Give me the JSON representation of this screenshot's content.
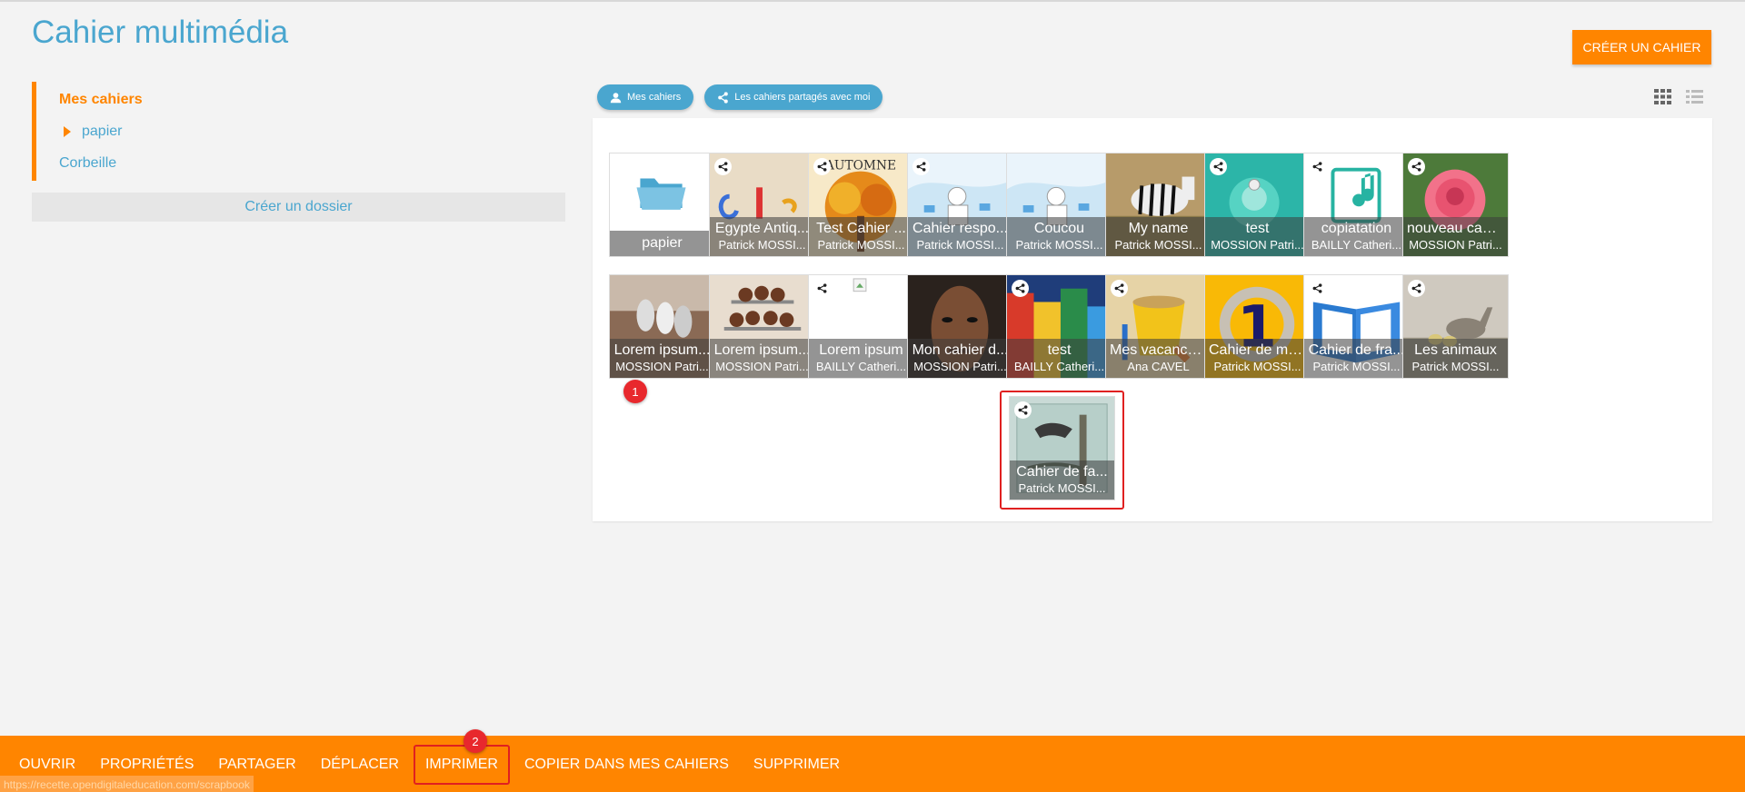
{
  "header": {
    "title": "Cahier multimédia",
    "create_label": "CRÉER UN CAHIER"
  },
  "sidebar": {
    "items": [
      {
        "label": "Mes cahiers"
      },
      {
        "label": "papier"
      },
      {
        "label": "Corbeille"
      }
    ],
    "create_folder_label": "Créer un dossier"
  },
  "filters": {
    "mine_label": "Mes cahiers",
    "shared_label": "Les cahiers partagés avec moi"
  },
  "colors": {
    "accent": "#ff8500",
    "link": "#4aa6cf",
    "highlight": "#e02020"
  },
  "tiles": [
    {
      "title": "papier",
      "author": "",
      "shared": false,
      "kind": "folder"
    },
    {
      "title": "Egypte Antiq...",
      "author": "Patrick MOSSI...",
      "shared": true,
      "kind": "letters"
    },
    {
      "title": "Test Cahier ...",
      "author": "Patrick MOSSI...",
      "shared": true,
      "kind": "autumn"
    },
    {
      "title": "Cahier respo...",
      "author": "Patrick MOSSI...",
      "shared": true,
      "kind": "illus"
    },
    {
      "title": "Coucou",
      "author": "Patrick MOSSI...",
      "shared": false,
      "kind": "illus"
    },
    {
      "title": "My name",
      "author": "Patrick MOSSI...",
      "shared": false,
      "kind": "zebra"
    },
    {
      "title": "test",
      "author": "MOSSION Patri...",
      "shared": true,
      "kind": "teal"
    },
    {
      "title": "copiatation",
      "author": "BAILLY Catheri...",
      "shared": true,
      "kind": "music"
    },
    {
      "title": "nouveau cahi...",
      "author": "MOSSION Patri...",
      "shared": true,
      "kind": "rose"
    },
    {
      "title": "Lorem ipsum...",
      "author": "MOSSION Patri...",
      "shared": false,
      "kind": "spoons"
    },
    {
      "title": "Lorem ipsum...",
      "author": "MOSSION Patri...",
      "shared": false,
      "kind": "cupcakes"
    },
    {
      "title": "Lorem ipsum",
      "author": "BAILLY Catheri...",
      "shared": true,
      "kind": "blank"
    },
    {
      "title": "Mon cahier d...",
      "author": "MOSSION Patri...",
      "shared": false,
      "kind": "face"
    },
    {
      "title": "test",
      "author": "BAILLY Catheri...",
      "shared": true,
      "kind": "houses"
    },
    {
      "title": "Mes vacance...",
      "author": "Ana CAVEL",
      "shared": true,
      "kind": "bucket"
    },
    {
      "title": "Cahier de ma...",
      "author": "Patrick MOSSI...",
      "shared": false,
      "kind": "one"
    },
    {
      "title": "Cahier de fra...",
      "author": "Patrick MOSSI...",
      "shared": true,
      "kind": "book"
    },
    {
      "title": "Les animaux",
      "author": "Patrick MOSSI...",
      "shared": true,
      "kind": "geese"
    },
    {
      "title": "Cahier de fa...",
      "author": "Patrick MOSSI...",
      "shared": true,
      "kind": "fable"
    }
  ],
  "markers": [
    "1",
    "2"
  ],
  "toolbar": {
    "items": [
      {
        "label": "OUVRIR"
      },
      {
        "label": "PROPRIÉTÉS"
      },
      {
        "label": "PARTAGER"
      },
      {
        "label": "DÉPLACER"
      },
      {
        "label": "IMPRIMER"
      },
      {
        "label": "COPIER DANS MES CAHIERS"
      },
      {
        "label": "SUPPRIMER"
      }
    ]
  },
  "status_url": "https://recette.opendigitaleducation.com/scrapbook"
}
